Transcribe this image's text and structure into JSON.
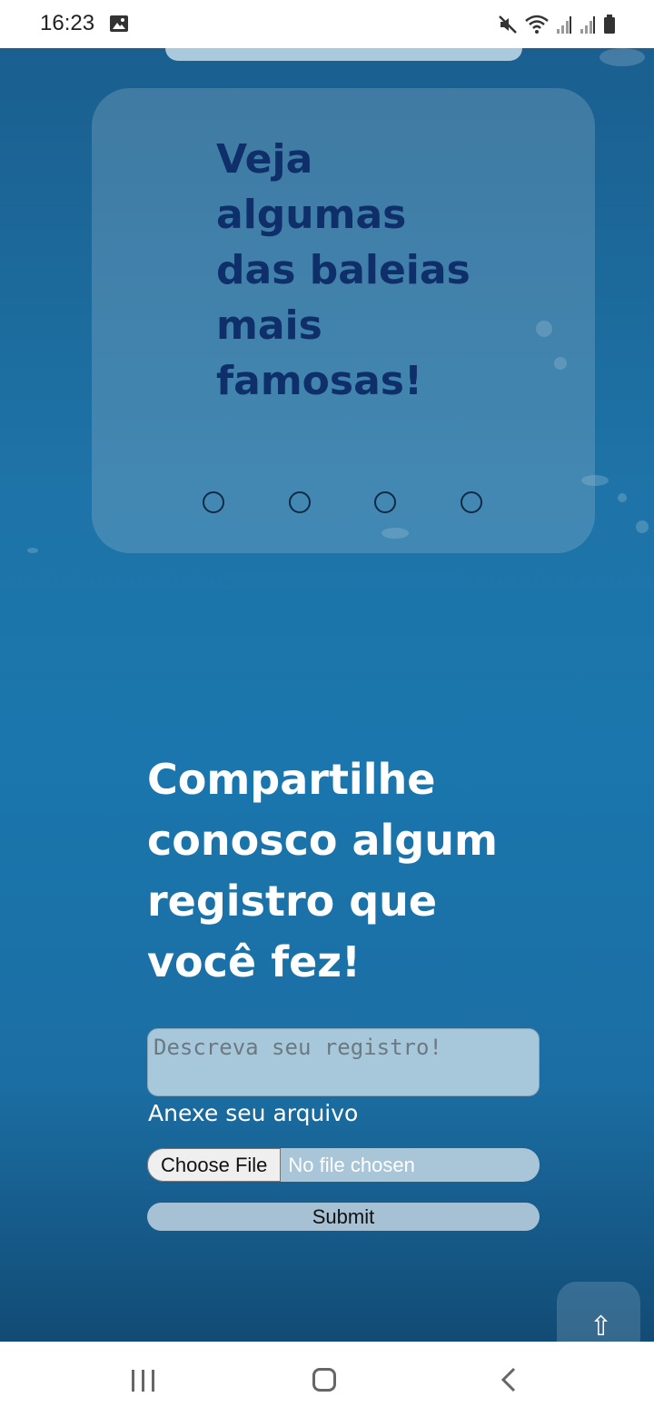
{
  "status_bar": {
    "time": "16:23",
    "icons": [
      "gallery-icon",
      "mute-icon",
      "wifi-icon",
      "signal-icon",
      "signal-icon-2",
      "battery-icon"
    ]
  },
  "carousel": {
    "title": "Veja algumas das baleias mais famosas!",
    "dots_count": 4
  },
  "share": {
    "title": "Compartilhe conosco algum registro que você fez!",
    "description_placeholder": "Descreva seu registro!",
    "file_label": "Anexe seu arquivo",
    "choose_file_label": "Choose File",
    "no_file_text": "No file chosen",
    "submit_label": "Submit"
  },
  "scroll_top": {
    "icon": "⇧"
  },
  "colors": {
    "ocean": "#1b6ea6",
    "carousel_title": "#0f2f6a",
    "field_bg": "#a7c8db"
  }
}
